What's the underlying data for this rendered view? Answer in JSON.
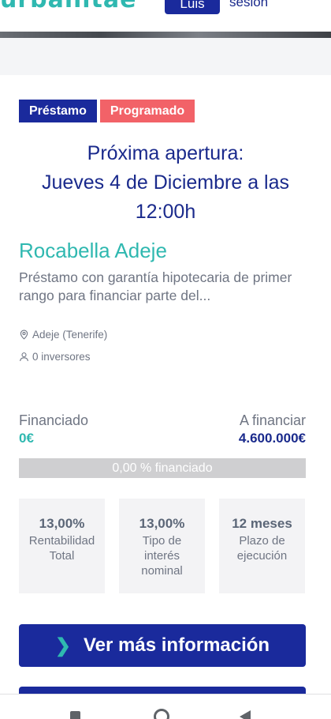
{
  "header": {
    "logo_fragment": "urbanitae",
    "user_button": "Luis",
    "session_link": "sesión"
  },
  "tags": {
    "loan": "Préstamo",
    "status": "Programado"
  },
  "opening": {
    "line1": "Próxima apertura:",
    "line2": "Jueves 4 de Diciembre a las",
    "line3": "12:00h"
  },
  "project": {
    "title": "Rocabella Adeje",
    "description": "Préstamo con garantía hipotecaria de primer rango para financiar parte del...",
    "location": "Adeje (Tenerife)",
    "investors": "0 inversores"
  },
  "funding": {
    "financed_label": "Financiado",
    "financed_value": "0€",
    "target_label": "A financiar",
    "target_value": "4.600.000€",
    "progress_fraction": 0,
    "progress_text": "0,00 % financiado"
  },
  "stats": [
    {
      "value": "13,00%",
      "label": "Rentabilidad Total"
    },
    {
      "value": "13,00%",
      "label": "Tipo de interés nominal"
    },
    {
      "value": "12 meses",
      "label": "Plazo de ejecución"
    }
  ],
  "more_button": {
    "label": "Ver más información",
    "icon": "chevron-right-icon"
  },
  "colors": {
    "brand_blue": "#1a2a9c",
    "teal": "#2fb8b0",
    "coral": "#f26268",
    "progress_track": "#cfcfd1"
  },
  "navbar": {
    "icons": [
      "recents-icon",
      "home-icon",
      "back-icon"
    ]
  }
}
